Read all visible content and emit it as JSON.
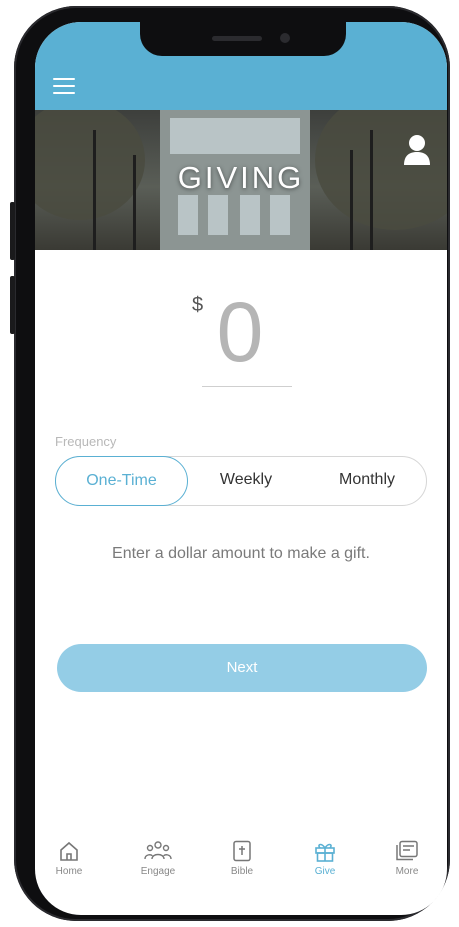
{
  "header": {
    "title": "GIVING",
    "menu_icon": "hamburger-menu-icon",
    "profile_icon": "user-profile-icon",
    "accent_color": "#5ab0d3"
  },
  "amount": {
    "currency_symbol": "$",
    "value": "0"
  },
  "frequency": {
    "label": "Frequency",
    "options": [
      "One-Time",
      "Weekly",
      "Monthly"
    ],
    "selected": "One-Time"
  },
  "helper_text": "Enter a dollar amount to make a gift.",
  "next_button": {
    "label": "Next",
    "color": "#94cde6"
  },
  "tabbar": {
    "tabs": [
      {
        "label": "Home",
        "icon": "home-icon"
      },
      {
        "label": "Engage",
        "icon": "people-icon"
      },
      {
        "label": "Bible",
        "icon": "bible-icon"
      },
      {
        "label": "Give",
        "icon": "gift-icon"
      },
      {
        "label": "More",
        "icon": "more-icon"
      }
    ],
    "active": "Give"
  }
}
